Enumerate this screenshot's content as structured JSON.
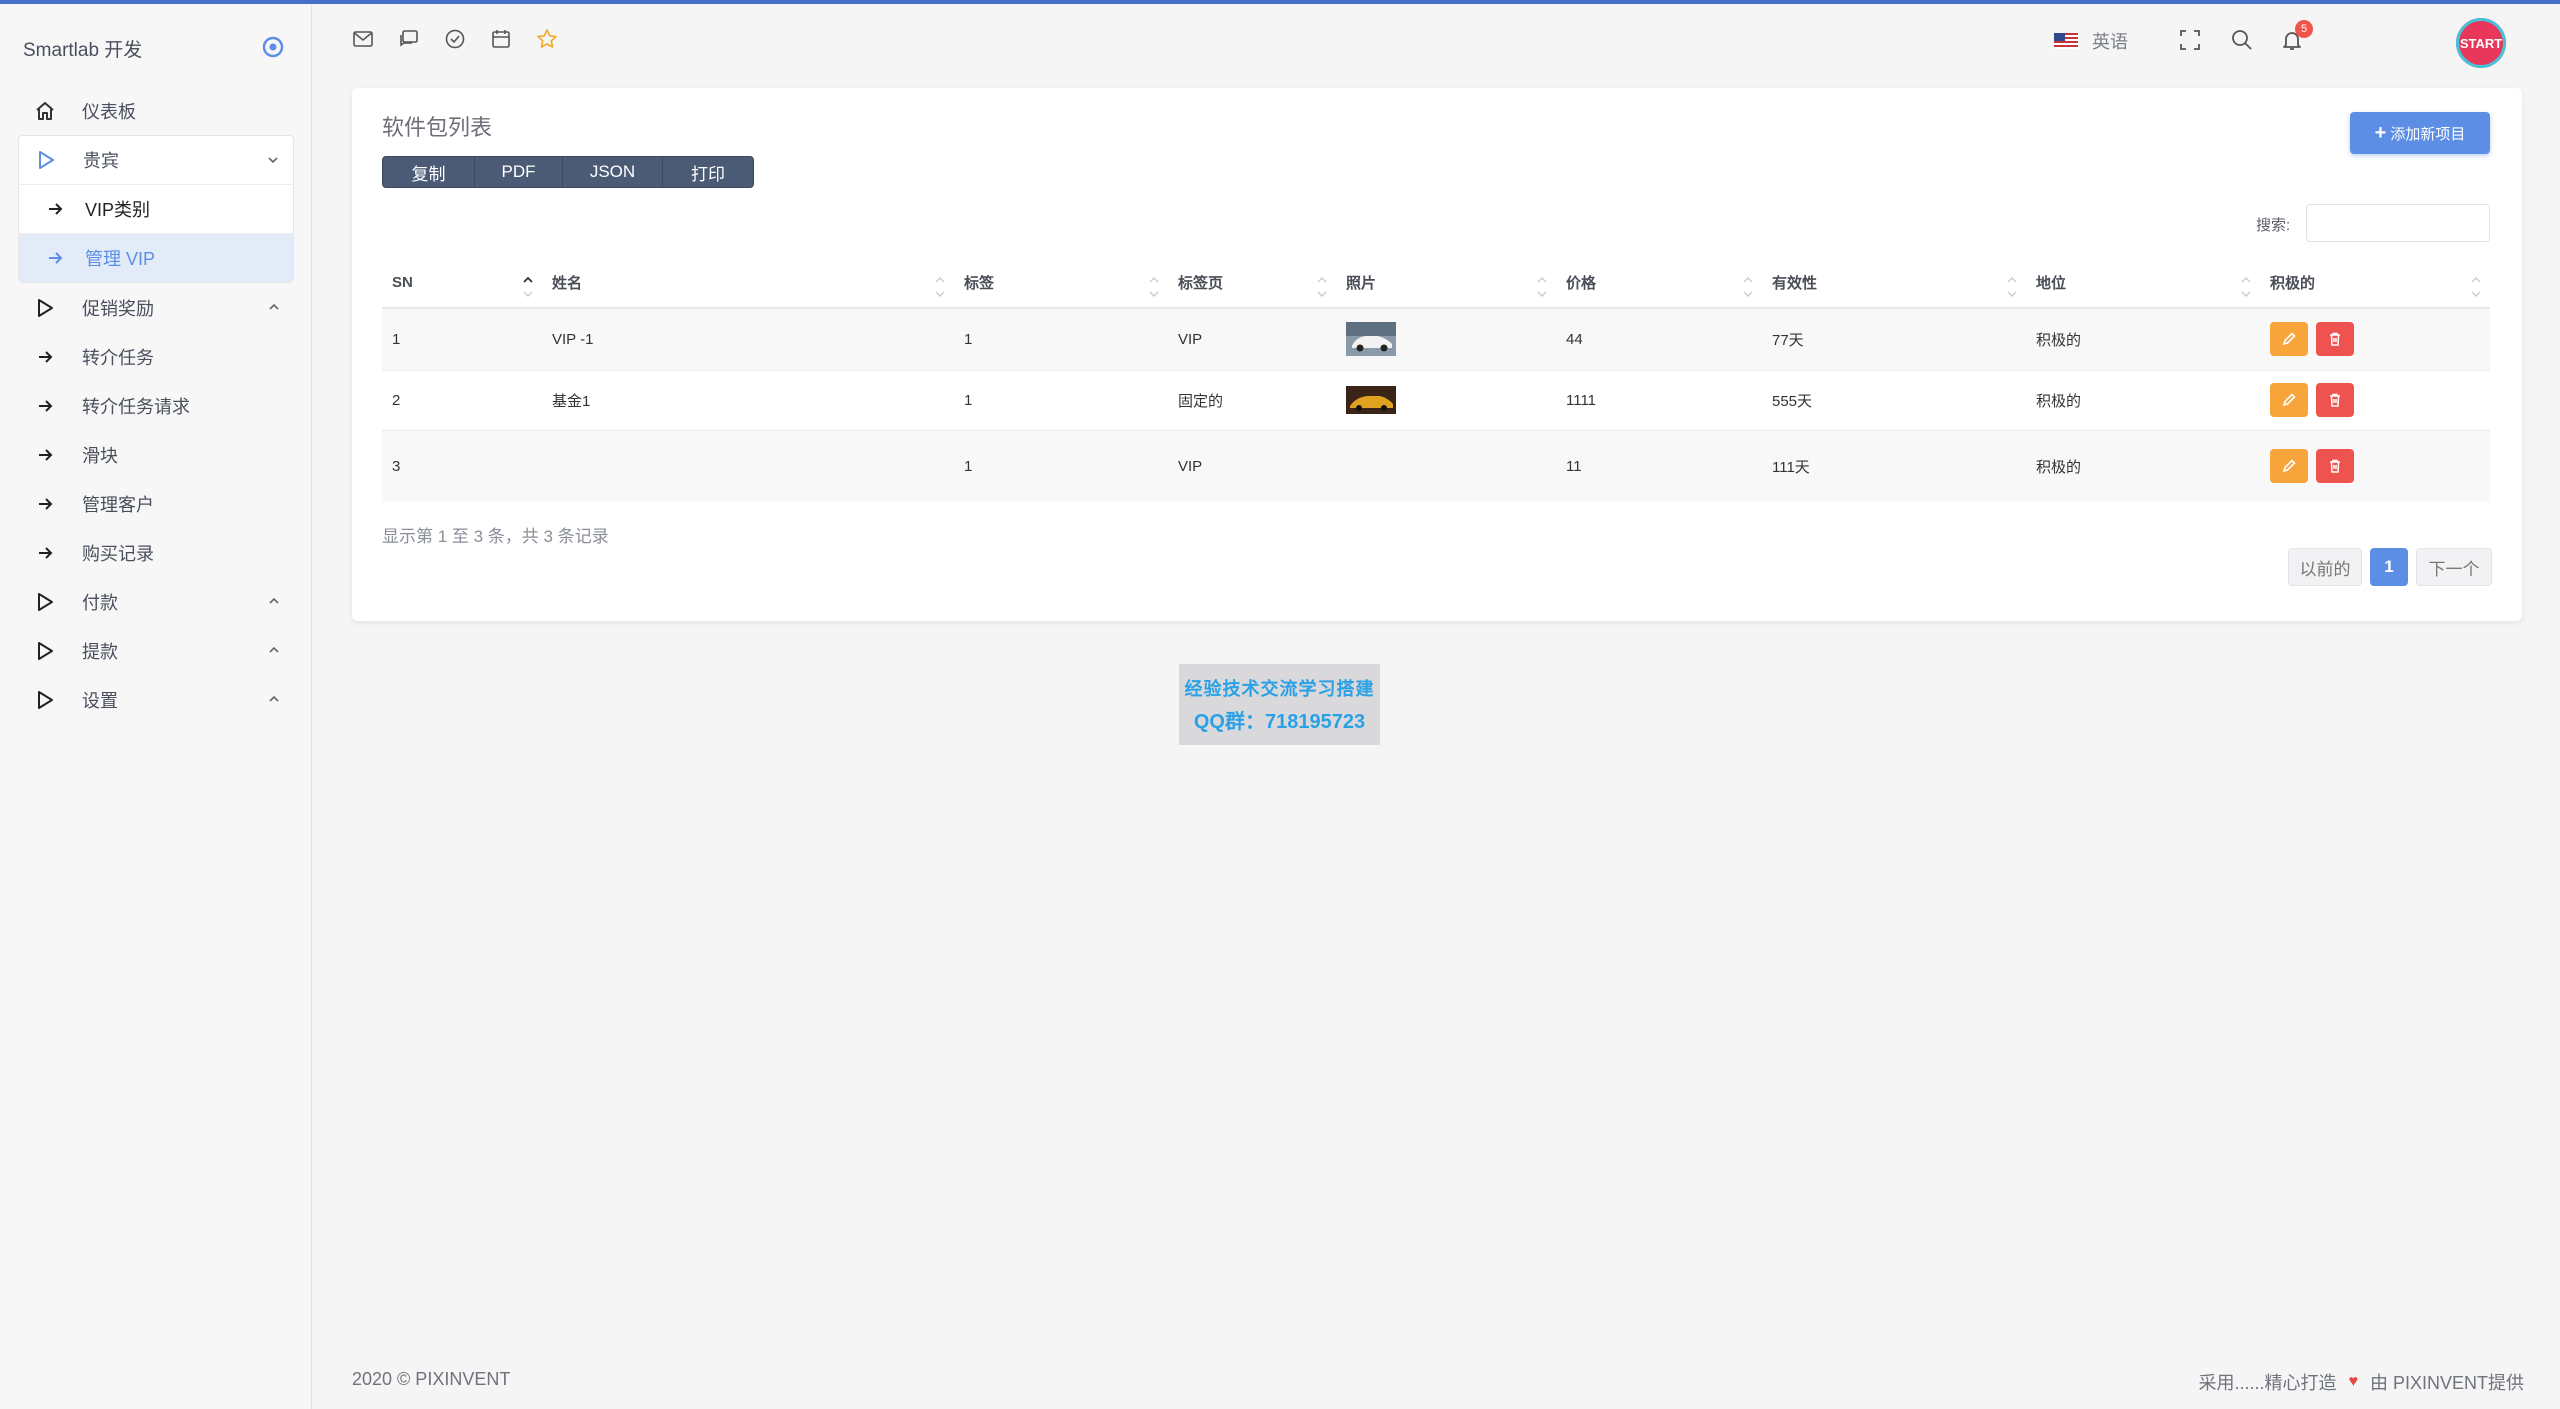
{
  "brand": {
    "name": "Smartlab 开发"
  },
  "sidebar": {
    "items": [
      {
        "label": "仪表板"
      },
      {
        "label": "贵宾"
      },
      {
        "label": "VIP类别"
      },
      {
        "label": "管理 VIP"
      },
      {
        "label": "促销奖励"
      },
      {
        "label": "转介任务"
      },
      {
        "label": "转介任务请求"
      },
      {
        "label": "滑块"
      },
      {
        "label": "管理客户"
      },
      {
        "label": "购买记录"
      },
      {
        "label": "付款"
      },
      {
        "label": "提款"
      },
      {
        "label": "设置"
      }
    ]
  },
  "header": {
    "language": "英语",
    "notifications_count": "5",
    "avatar_text": "START"
  },
  "card": {
    "title": "软件包列表",
    "export_buttons": [
      "复制",
      "PDF",
      "JSON",
      "打印"
    ],
    "add_button": "添加新项目",
    "search_label": "搜索:",
    "search_value": ""
  },
  "table": {
    "headers": [
      "SN",
      "姓名",
      "标签",
      "标签页",
      "照片",
      "价格",
      "有效性",
      "地位",
      "积极的"
    ],
    "rows": [
      {
        "sn": "1",
        "name": "VIP -1",
        "tag": "1",
        "tab": "VIP",
        "photo": "car-white",
        "price": "44",
        "validity": "77天",
        "status": "积极的"
      },
      {
        "sn": "2",
        "name": "基金1",
        "tag": "1",
        "tab": "固定的",
        "photo": "car-gold",
        "price": "1111",
        "validity": "555天",
        "status": "积极的"
      },
      {
        "sn": "3",
        "name": "",
        "tag": "1",
        "tab": "VIP",
        "photo": "",
        "price": "11",
        "validity": "111天",
        "status": "积极的"
      }
    ]
  },
  "pagination": {
    "info": "显示第 1 至 3 条，共 3 条记录",
    "prev": "以前的",
    "current": "1",
    "next": "下一个"
  },
  "promo": {
    "line1": "经验技术交流学习搭建",
    "line2": "QQ群：718195723"
  },
  "footer": {
    "left": "2020 © PIXINVENT",
    "right_prefix": "采用......精心打造",
    "right_suffix": "由 PIXINVENT提供"
  },
  "colors": {
    "accent": "#5c8ee6",
    "export_bg": "#4b5b75",
    "edit": "#f7a53a",
    "delete": "#ef5350",
    "badge": "#f0554c"
  }
}
